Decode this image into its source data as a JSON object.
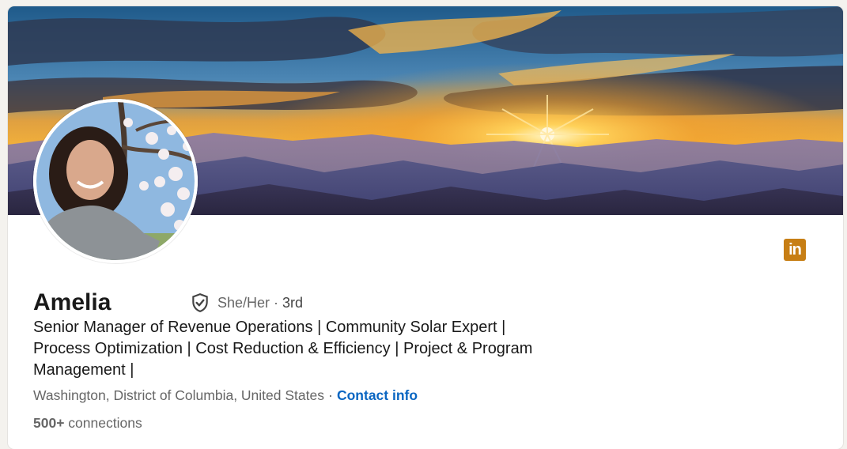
{
  "profile": {
    "name": "Amelia",
    "pronouns": "She/Her",
    "separator": "·",
    "degree": "3rd",
    "headline": "Senior Manager of Revenue Operations | Community Solar Expert | Process Optimization | Cost Reduction & Efficiency | Project & Program Management |",
    "location": "Washington, District of Columbia, United States",
    "contact_label": "Contact info",
    "connections_count": "500+",
    "connections_label": "connections"
  },
  "badges": {
    "linkedin_logo_text": "in",
    "verification_icon": "shield-check-icon"
  },
  "colors": {
    "link": "#0a66c2",
    "linkedin_badge": "#c77e14",
    "text_primary": "#191919",
    "text_secondary": "#666666"
  }
}
